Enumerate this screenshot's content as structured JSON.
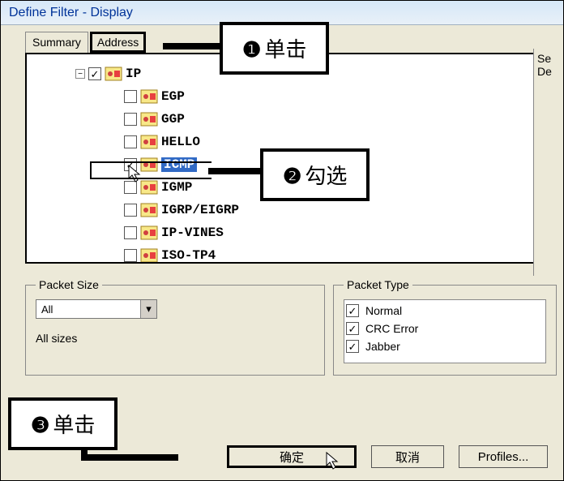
{
  "window": {
    "title": "Define Filter - Display"
  },
  "tabs": {
    "summary": "Summary",
    "address": "Address"
  },
  "side": {
    "line1": "Se",
    "line2": "De"
  },
  "tree": {
    "root": {
      "label": "IP",
      "checked": true
    },
    "children": [
      {
        "label": "EGP",
        "checked": false
      },
      {
        "label": "GGP",
        "checked": false
      },
      {
        "label": "HELLO",
        "checked": false
      },
      {
        "label": "ICMP",
        "checked": true,
        "selected": true
      },
      {
        "label": "IGMP",
        "checked": false
      },
      {
        "label": "IGRP/EIGRP",
        "checked": false
      },
      {
        "label": "IP-VINES",
        "checked": false
      },
      {
        "label": "ISO-TP4",
        "checked": false
      }
    ]
  },
  "packetSize": {
    "legend": "Packet Size",
    "combo": "All",
    "note": "All sizes"
  },
  "packetType": {
    "legend": "Packet Type",
    "items": [
      {
        "label": "Normal",
        "checked": true
      },
      {
        "label": "CRC Error",
        "checked": true
      },
      {
        "label": "Jabber",
        "checked": true
      }
    ]
  },
  "buttons": {
    "ok": "确定",
    "cancel": "取消",
    "profiles": "Profiles..."
  },
  "callouts": {
    "c1": {
      "num": "❶",
      "text": "单击"
    },
    "c2": {
      "num": "❷",
      "text": "勾选"
    },
    "c3": {
      "num": "❸",
      "text": "单击"
    }
  }
}
